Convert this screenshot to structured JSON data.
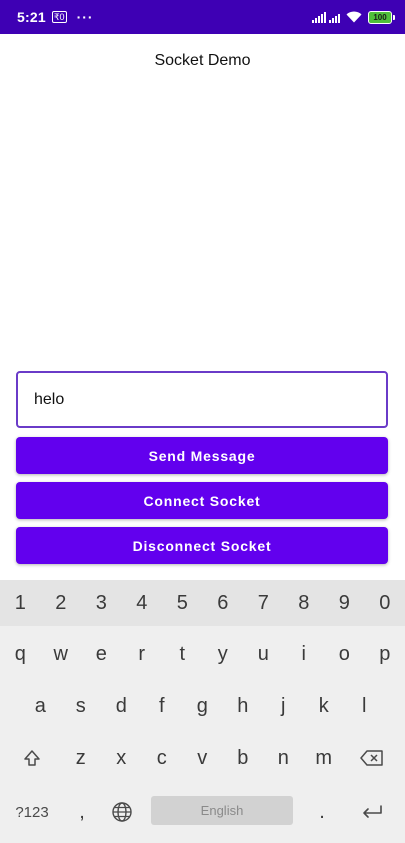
{
  "status_bar": {
    "time": "5:21",
    "notification_badge": "₹0",
    "more": "···",
    "battery": "100",
    "color": "#3e00b4"
  },
  "app": {
    "title": "Socket Demo",
    "message_input": {
      "value": "helo",
      "placeholder": ""
    },
    "buttons": {
      "send": "Send Message",
      "connect": "Connect Socket",
      "disconnect": "Disconnect Socket"
    },
    "accent_color": "#6200ee"
  },
  "keyboard": {
    "number_row": [
      "1",
      "2",
      "3",
      "4",
      "5",
      "6",
      "7",
      "8",
      "9",
      "0"
    ],
    "row1": [
      "q",
      "w",
      "e",
      "r",
      "t",
      "y",
      "u",
      "i",
      "o",
      "p"
    ],
    "row2": [
      "a",
      "s",
      "d",
      "f",
      "g",
      "h",
      "j",
      "k",
      "l"
    ],
    "row3": [
      "z",
      "x",
      "c",
      "v",
      "b",
      "n",
      "m"
    ],
    "symbols_key": "?123",
    "comma_key": ",",
    "space_label": "English",
    "period_key": ".",
    "icons": {
      "shift": "shift-icon",
      "backspace": "backspace-icon",
      "globe": "globe-icon",
      "enter": "enter-icon"
    }
  }
}
